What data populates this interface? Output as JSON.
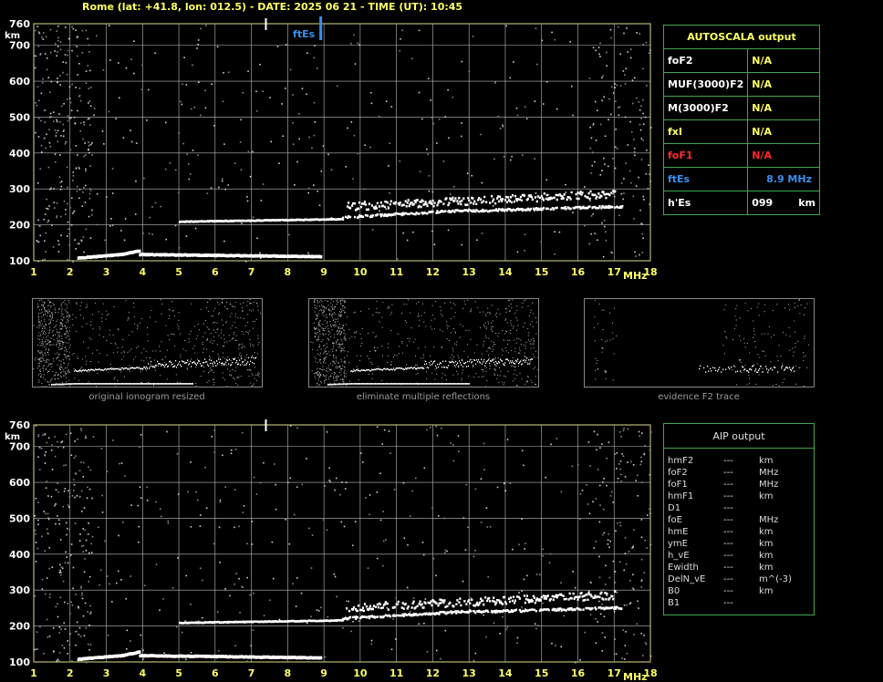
{
  "header": {
    "title": "Rome (lat: +41.8, lon: 012.5) - DATE: 2025 06 21 - TIME (UT): 10:45"
  },
  "colors": {
    "grid": "#bcbcbc",
    "tick_label": "#ffff66",
    "panel_border": "#3fa64a",
    "fte_marker": "#3a8ff0",
    "fof1_red": "#ff2a2a",
    "fxi_yellow": "#ffff66"
  },
  "chart_data": [
    {
      "type": "scatter",
      "name_role": "ionogram-top",
      "xlabel": "MHz",
      "ylabel": "km",
      "xlim": [
        1,
        18
      ],
      "ylim": [
        100,
        760
      ],
      "x_ticks": [
        1,
        2,
        3,
        4,
        5,
        6,
        7,
        8,
        9,
        10,
        11,
        12,
        13,
        14,
        15,
        16,
        17,
        18
      ],
      "y_ticks": [
        100,
        200,
        300,
        400,
        500,
        600,
        700,
        760
      ],
      "grid": true,
      "markers": [
        {
          "label": "ftEs",
          "x": 8.9
        },
        {
          "label": "",
          "x": 7.4
        }
      ],
      "traces": [
        {
          "x_start": 2.2,
          "x_end": 3.4,
          "y_start": 108,
          "y_end": 118
        },
        {
          "x_start": 3.4,
          "x_end": 3.9,
          "y_start": 118,
          "y_end": 128
        },
        {
          "x_start": 3.9,
          "x_end": 8.9,
          "y_start": 118,
          "y_end": 112
        },
        {
          "x_start": 5.0,
          "x_end": 9.5,
          "y_start": 208,
          "y_end": 215
        },
        {
          "x_start": 9.5,
          "x_end": 13.0,
          "y_start": 220,
          "y_end": 240
        },
        {
          "x_start": 13.0,
          "x_end": 17.2,
          "y_start": 238,
          "y_end": 250
        },
        {
          "x_start": 9.6,
          "x_end": 17.0,
          "y_start": 250,
          "y_end": 285
        }
      ]
    },
    {
      "type": "scatter",
      "name_role": "ionogram-bottom",
      "xlabel": "MHz",
      "ylabel": "km",
      "xlim": [
        1,
        18
      ],
      "ylim": [
        100,
        760
      ],
      "x_ticks": [
        1,
        2,
        3,
        4,
        5,
        6,
        7,
        8,
        9,
        10,
        11,
        12,
        13,
        14,
        15,
        16,
        17,
        18
      ],
      "y_ticks": [
        100,
        200,
        300,
        400,
        500,
        600,
        700,
        760
      ],
      "grid": true,
      "markers": [
        {
          "label": "",
          "x": 7.4
        }
      ],
      "traces": [
        {
          "x_start": 2.2,
          "x_end": 3.4,
          "y_start": 108,
          "y_end": 118
        },
        {
          "x_start": 3.4,
          "x_end": 3.9,
          "y_start": 118,
          "y_end": 128
        },
        {
          "x_start": 3.9,
          "x_end": 8.9,
          "y_start": 118,
          "y_end": 112
        },
        {
          "x_start": 5.0,
          "x_end": 9.5,
          "y_start": 208,
          "y_end": 215
        },
        {
          "x_start": 9.5,
          "x_end": 13.0,
          "y_start": 220,
          "y_end": 240
        },
        {
          "x_start": 13.0,
          "x_end": 17.2,
          "y_start": 238,
          "y_end": 250
        },
        {
          "x_start": 9.6,
          "x_end": 17.0,
          "y_start": 250,
          "y_end": 285
        }
      ]
    }
  ],
  "thumbnails": [
    {
      "caption": "original ionogram resized"
    },
    {
      "caption": "eliminate multiple reflections"
    },
    {
      "caption": "evidence F2 trace"
    }
  ],
  "autoscala": {
    "title": "AUTOSCALA output",
    "rows": [
      {
        "label": "foF2",
        "value": "N/A",
        "unit": ""
      },
      {
        "label": "MUF(3000)F2",
        "value": "N/A",
        "unit": ""
      },
      {
        "label": "M(3000)F2",
        "value": "N/A",
        "unit": ""
      },
      {
        "label": "fxI",
        "value": "N/A",
        "unit": ""
      },
      {
        "label": "foF1",
        "value": "N/A",
        "unit": ""
      },
      {
        "label": "ftEs",
        "value": "8.9 MHz",
        "unit": ""
      },
      {
        "label": "h'Es",
        "value": "099",
        "unit": "km"
      }
    ]
  },
  "aip": {
    "title": "AIP output",
    "rows": [
      {
        "label": "hmF2",
        "value": "---",
        "unit": "km"
      },
      {
        "label": "foF2",
        "value": "---",
        "unit": "MHz"
      },
      {
        "label": "foF1",
        "value": "---",
        "unit": "MHz"
      },
      {
        "label": "hmF1",
        "value": "---",
        "unit": "km"
      },
      {
        "label": "D1",
        "value": "---",
        "unit": ""
      },
      {
        "label": "foE",
        "value": "---",
        "unit": "MHz"
      },
      {
        "label": "hmE",
        "value": "---",
        "unit": "km"
      },
      {
        "label": "ymE",
        "value": "---",
        "unit": "km"
      },
      {
        "label": "h_vE",
        "value": "---",
        "unit": "km"
      },
      {
        "label": "Ewidth",
        "value": "---",
        "unit": "km"
      },
      {
        "label": "DelN_vE",
        "value": "---",
        "unit": "m^(-3)"
      },
      {
        "label": "B0",
        "value": "---",
        "unit": "km"
      },
      {
        "label": "B1",
        "value": "---",
        "unit": ""
      }
    ]
  }
}
